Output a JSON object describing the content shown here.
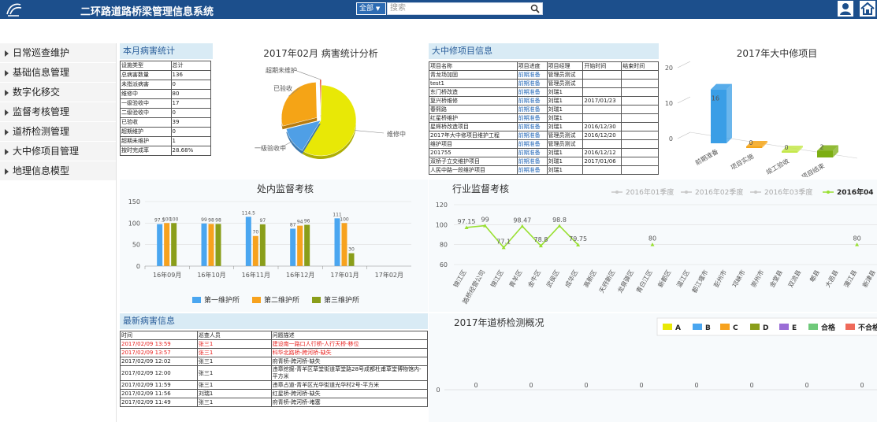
{
  "header": {
    "title": "二环路道路桥梁管理信息系统",
    "scope": "全部",
    "search_placeholder": "搜索"
  },
  "sidebar": {
    "items": [
      "日常巡查维护",
      "基础信息管理",
      "数字化移交",
      "监督考核管理",
      "道桥检测管理",
      "大中修项目管理",
      "地理信息模型"
    ]
  },
  "month_stats": {
    "title": "本月病害统计",
    "headers": [
      "设施类型",
      "总计"
    ],
    "rows": [
      [
        "总病害数量",
        "136"
      ],
      [
        "未指派病害",
        "0"
      ],
      [
        "维修中",
        "80"
      ],
      [
        "一级验收中",
        "17"
      ],
      [
        "二级验收中",
        "0"
      ],
      [
        "已验收",
        "39"
      ],
      [
        "超期维护",
        "0"
      ],
      [
        "超期未维护",
        "1"
      ],
      [
        "按时完成率",
        "28.68%"
      ]
    ]
  },
  "disease_chart": {
    "type": "pie",
    "title": "2017年02月 病害统计分析",
    "labels": [
      "维修中",
      "一级验收中",
      "已验收",
      "超期未维护"
    ],
    "values": [
      80,
      17,
      39,
      1
    ],
    "colors": [
      "#e8e806",
      "#4f9fe6",
      "#f5a416",
      "#e84f2c"
    ]
  },
  "project_info": {
    "title": "大中修项目信息",
    "headers": [
      "项目名称",
      "项目进度",
      "项目经理",
      "开始时间",
      "结束时间"
    ],
    "rows": [
      [
        "青龙场加固",
        "前期准备",
        "管理员测试",
        "",
        ""
      ],
      [
        "test1",
        "前期准备",
        "管理员测试",
        "",
        ""
      ],
      [
        "东门桥改造",
        "前期准备",
        "刘瑞1",
        "",
        ""
      ],
      [
        "复兴桥维修",
        "前期准备",
        "刘瑞1",
        "2017/01/23",
        ""
      ],
      [
        "春熙路",
        "前期准备",
        "刘瑞1",
        "",
        ""
      ],
      [
        "红星桥维护",
        "前期准备",
        "刘瑞1",
        "",
        ""
      ],
      [
        "星辉桥改造项目",
        "前期准备",
        "刘瑞1",
        "2016/12/30",
        ""
      ],
      [
        "2017年大中修项目维护工程",
        "前期准备",
        "管理员测试",
        "2016/12/20",
        ""
      ],
      [
        "维护项目",
        "前期准备",
        "管理员测试",
        "",
        ""
      ],
      [
        "201755",
        "前期准备",
        "刘瑞1",
        "2016/12/12",
        ""
      ],
      [
        "双桥子立交维护项目",
        "前期准备",
        "刘瑞1",
        "2017/01/06",
        ""
      ],
      [
        "人民中路一段维护项目",
        "前期准备",
        "刘瑞1",
        "",
        ""
      ]
    ]
  },
  "project_chart": {
    "type": "bar",
    "title": "2017年大中修项目",
    "categories": [
      "前期准备",
      "项目实施",
      "竣工验收",
      "项目结束"
    ],
    "values": [
      16,
      0,
      0,
      2
    ],
    "ylim": [
      0,
      20
    ],
    "yticks": [
      0,
      10,
      20
    ],
    "colors": [
      "#3a9ee6",
      "#f5a416",
      "#c4e84a",
      "#7cae12"
    ]
  },
  "supervision_chart": {
    "type": "bar",
    "title": "处内监督考核",
    "categories": [
      "16年09月",
      "16年10月",
      "16年11月",
      "16年12月",
      "17年01月",
      "17年02月"
    ],
    "series": [
      {
        "name": "第一维护所",
        "color": "#4aa6f0",
        "values": [
          97.5,
          99,
          114.5,
          87,
          111,
          null
        ]
      },
      {
        "name": "第二维护所",
        "color": "#f7a21e",
        "values": [
          100,
          98,
          70,
          94,
          100,
          null
        ]
      },
      {
        "name": "第三维护所",
        "color": "#8a9e1a",
        "values": [
          100,
          98,
          97,
          96,
          30,
          null
        ]
      }
    ],
    "labels": [
      [
        "97.5",
        "100",
        "100"
      ],
      [
        "99",
        "98",
        "98"
      ],
      [
        "114.5",
        "70",
        "97"
      ],
      [
        "87",
        "94",
        "96"
      ],
      [
        "111",
        "100",
        "30"
      ],
      [
        "",
        "",
        ""
      ]
    ],
    "ylim": [
      0,
      150
    ],
    "yticks": [
      0,
      50,
      100,
      150
    ]
  },
  "industry_chart": {
    "type": "line",
    "title": "行业监督考核",
    "legend": [
      "2016年01季度",
      "2016年02季度",
      "2016年03季度",
      "2016年04"
    ],
    "legend_colors": [
      "#c8c8c8",
      "#c8c8c8",
      "#c8c8c8",
      "#99e032"
    ],
    "categories": [
      "锦江区",
      "路桥经营公司",
      "锦江区",
      "青羊区",
      "金牛区",
      "武侯区",
      "成华区",
      "高新区",
      "天府新区",
      "龙泉驿区",
      "青白江区",
      "新都区",
      "温江区",
      "都江堰市",
      "彭州市",
      "邛崃市",
      "崇州市",
      "金堂县",
      "双流县",
      "郫县",
      "大邑县",
      "蒲江县",
      "新津县",
      "简阳市"
    ],
    "values": [
      97.15,
      99,
      77.1,
      98.47,
      78.8,
      98.8,
      79.75,
      null,
      null,
      null,
      80,
      null,
      null,
      null,
      null,
      null,
      null,
      null,
      null,
      null,
      null,
      80,
      null,
      null
    ],
    "point_labels": [
      "97.15",
      "99",
      "77.1",
      "98.47",
      "78.8",
      "98.8",
      "79.75",
      "",
      "",
      "",
      "80",
      "",
      "",
      "",
      "",
      "",
      "",
      "",
      "",
      "",
      "",
      "80",
      "",
      ""
    ],
    "ylim": [
      60,
      120
    ],
    "yticks": [
      60,
      80,
      100,
      120
    ],
    "color": "#99e032"
  },
  "latest_disease": {
    "title": "最新病害信息",
    "headers": [
      "时间",
      "巡查人员",
      "问题描述"
    ],
    "rows": [
      {
        "time": "2017/02/09 13:59",
        "person": "张三1",
        "desc": "建设南一路口人行桥-人行天桥-移位",
        "red": true
      },
      {
        "time": "2017/02/09 13:57",
        "person": "张三1",
        "desc": "科华北路桥-跨河桥-缺失",
        "red": true
      },
      {
        "time": "2017/02/09 12:02",
        "person": "张三1",
        "desc": "府青桥-跨河桥-缺失",
        "red": false
      },
      {
        "time": "2017/02/09 12:00",
        "person": "张三1",
        "desc": "违章挖掘-青羊区草堂街道草堂路28号成都杜甫草堂博物馆内-平方米",
        "red": false
      },
      {
        "time": "2017/02/09 11:59",
        "person": "张三1",
        "desc": "违章占道-青羊区光华街道光华村2号-平方米",
        "red": false
      },
      {
        "time": "2017/02/09 11:56",
        "person": "刘瑞1",
        "desc": "红星桥-跨河桥-缺失",
        "red": false
      },
      {
        "time": "2017/02/09 11:49",
        "person": "张三1",
        "desc": "府青桥-跨河桥-堵塞",
        "red": false
      }
    ]
  },
  "detection_chart": {
    "type": "line",
    "title": "2017年道桥检测概况",
    "legend": [
      "A",
      "B",
      "C",
      "D",
      "E",
      "合格",
      "不合格"
    ],
    "legend_colors": [
      "#e8e806",
      "#4aa6f0",
      "#f7a21e",
      "#8a9e1a",
      "#9a6dd6",
      "#6fc97a",
      "#ef6a5a"
    ],
    "values": [
      0,
      0,
      0,
      0,
      0,
      0,
      0,
      0
    ],
    "point_labels": [
      "0",
      "0",
      "0",
      "0",
      "0",
      "0",
      "0",
      "0"
    ],
    "y_tick": "0"
  }
}
